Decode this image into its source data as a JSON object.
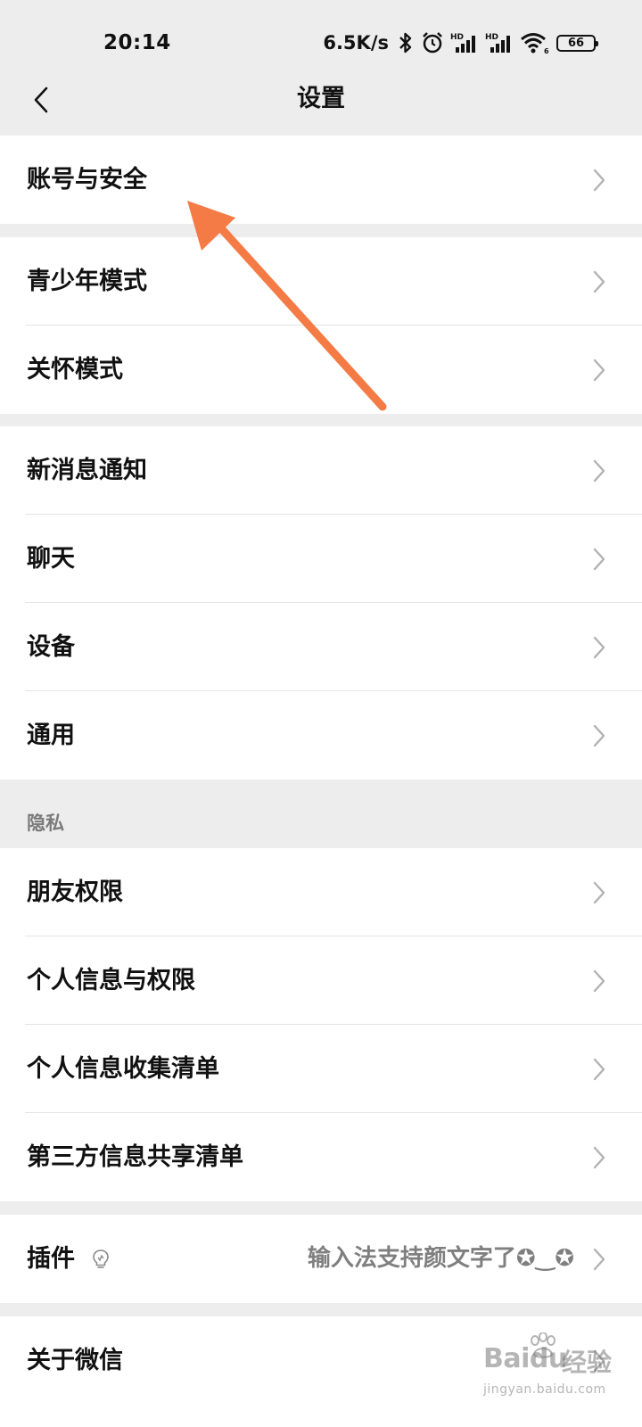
{
  "status_bar": {
    "time": "20:14",
    "net_speed": "6.5K/s",
    "battery": "66",
    "icons": [
      "bluetooth-icon",
      "alarm-icon",
      "signal-hd-icon",
      "signal-hd-icon",
      "wifi-icon",
      "battery-icon"
    ]
  },
  "nav": {
    "back_icon": "chevron-left-icon",
    "title": "设置"
  },
  "groups": {
    "account": {
      "label": "账号与安全"
    },
    "modes": [
      {
        "label": "青少年模式"
      },
      {
        "label": "关怀模式"
      }
    ],
    "general": [
      {
        "label": "新消息通知"
      },
      {
        "label": "聊天"
      },
      {
        "label": "设备"
      },
      {
        "label": "通用"
      }
    ],
    "privacy": {
      "header": "隐私",
      "items": [
        {
          "label": "朋友权限"
        },
        {
          "label": "个人信息与权限"
        },
        {
          "label": "个人信息收集清单"
        },
        {
          "label": "第三方信息共享清单"
        }
      ]
    },
    "plugins": {
      "label": "插件",
      "icon": "lightbulb-icon",
      "value": "输入法支持颜文字了✪‿✪"
    },
    "about": {
      "label": "关于微信"
    }
  },
  "annotation": {
    "arrow_color": "#f47b45"
  },
  "watermark": {
    "brand": "Bai",
    "brand_suffix": "du",
    "cn": "经验",
    "url": "jingyan.baidu.com"
  }
}
